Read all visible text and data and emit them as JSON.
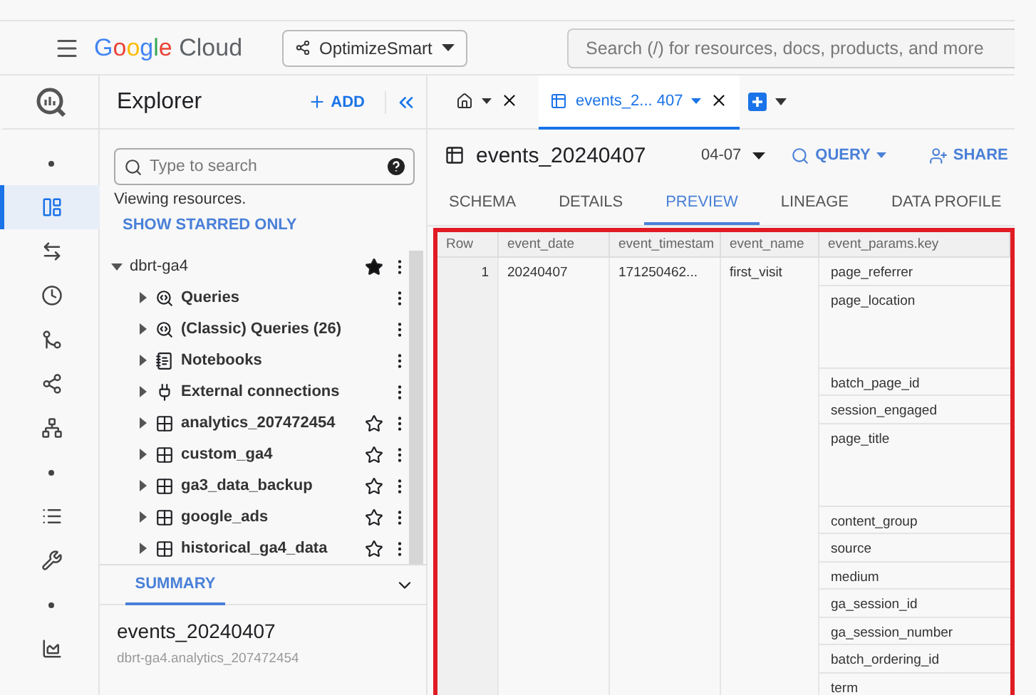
{
  "header": {
    "brand": "Google",
    "product": "Cloud",
    "project": "OptimizeSmart",
    "search": {
      "placeholder": "Search (/) for resources, docs, products, and more"
    }
  },
  "rail": [
    {
      "kind": "dot",
      "selected": false
    },
    {
      "kind": "explorer",
      "selected": true
    },
    {
      "kind": "transfer",
      "selected": false
    },
    {
      "kind": "history",
      "selected": false
    },
    {
      "kind": "flow",
      "selected": false
    },
    {
      "kind": "pipeline",
      "selected": false
    },
    {
      "kind": "nodes",
      "selected": false
    },
    {
      "kind": "dot",
      "selected": false
    },
    {
      "kind": "list",
      "selected": false
    },
    {
      "kind": "wrench",
      "selected": false
    },
    {
      "kind": "dot",
      "selected": false
    },
    {
      "kind": "chart",
      "selected": false
    }
  ],
  "explorer": {
    "title": "Explorer",
    "add": "ADD",
    "search": {
      "placeholder": "Type to search"
    },
    "note": "Viewing resources.",
    "starred_link": "SHOW STARRED ONLY",
    "tree": {
      "label": "dbrt-ga4",
      "expanded": true,
      "starred": true,
      "children": [
        {
          "label": "Queries",
          "kind": "query",
          "expanded": false
        },
        {
          "label": "(Classic) Queries (26)",
          "kind": "query",
          "expanded": false
        },
        {
          "label": "Notebooks",
          "kind": "notebook",
          "expanded": false
        },
        {
          "label": "External connections",
          "kind": "connection",
          "expanded": false
        },
        {
          "label": "analytics_207472454",
          "kind": "dataset",
          "expanded": false,
          "starred": false
        },
        {
          "label": "custom_ga4",
          "kind": "dataset",
          "expanded": false,
          "starred": false
        },
        {
          "label": "ga3_data_backup",
          "kind": "dataset",
          "expanded": false,
          "starred": false
        },
        {
          "label": "google_ads",
          "kind": "dataset",
          "expanded": false,
          "starred": false
        },
        {
          "label": "historical_ga4_data",
          "kind": "dataset",
          "expanded": false,
          "starred": false
        }
      ]
    },
    "summary": {
      "tab": "SUMMARY",
      "title": "events_20240407",
      "subtitle": "dbrt-ga4.analytics_207472454"
    }
  },
  "tabs": [
    {
      "kind": "home",
      "selected": false
    },
    {
      "kind": "table",
      "label": "events_2... 407",
      "selected": true
    }
  ],
  "table_view": {
    "title": "events_20240407",
    "date": "04-07",
    "query": "QUERY",
    "share": "SHARE",
    "subtabs": [
      {
        "label": "SCHEMA",
        "selected": false
      },
      {
        "label": "DETAILS",
        "selected": false
      },
      {
        "label": "PREVIEW",
        "selected": true
      },
      {
        "label": "LINEAGE",
        "selected": false
      },
      {
        "label": "DATA PROFILE",
        "selected": false
      }
    ],
    "columns": [
      "Row",
      "event_date",
      "event_timestam",
      "event_name",
      "event_params.key"
    ],
    "rows": [
      {
        "row": "1",
        "event_date": "20240407",
        "event_timestamp": "171250462...",
        "event_name": "first_visit",
        "params": [
          {
            "key": "page_referrer",
            "kind": "short"
          },
          {
            "key": "page_location",
            "kind": "tall"
          },
          {
            "key": "batch_page_id",
            "kind": "short"
          },
          {
            "key": "session_engaged",
            "kind": "short"
          },
          {
            "key": "page_title",
            "kind": "tall"
          },
          {
            "key": "content_group",
            "kind": "short"
          },
          {
            "key": "source",
            "kind": "short"
          },
          {
            "key": "medium",
            "kind": "short"
          },
          {
            "key": "ga_session_id",
            "kind": "short"
          },
          {
            "key": "ga_session_number",
            "kind": "short"
          },
          {
            "key": "batch_ordering_id",
            "kind": "short"
          },
          {
            "key": "term",
            "kind": "short"
          }
        ]
      }
    ]
  }
}
